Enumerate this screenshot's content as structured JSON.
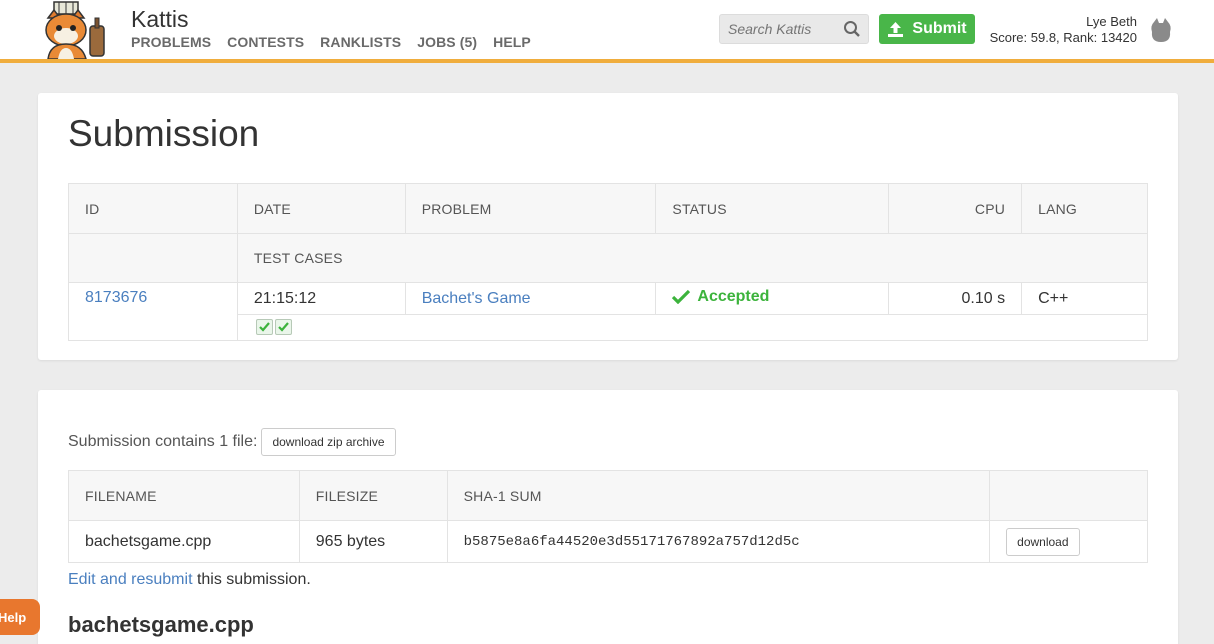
{
  "header": {
    "brand": "Kattis",
    "nav": [
      "PROBLEMS",
      "CONTESTS",
      "RANKLISTS",
      "JOBS (5)",
      "HELP"
    ],
    "search_placeholder": "Search Kattis",
    "submit_label": "Submit",
    "user_name": "Lye Beth",
    "user_score": "Score: 59.8, Rank: 13420",
    "accent_color": "#f0ad3d"
  },
  "submission": {
    "title": "Submission",
    "columns": [
      "ID",
      "DATE",
      "PROBLEM",
      "STATUS",
      "CPU",
      "LANG"
    ],
    "test_cases_label": "TEST CASES",
    "row": {
      "id": "8173676",
      "date": "21:15:12",
      "problem": "Bachet's Game",
      "status": "Accepted",
      "cpu": "0.10 s",
      "lang": "C++"
    },
    "test_case_results": [
      "passed",
      "passed"
    ],
    "status_color": "#3cb33c"
  },
  "files": {
    "contains_text": "Submission contains 1 file:",
    "download_zip_label": "download zip archive",
    "columns": [
      "FILENAME",
      "FILESIZE",
      "SHA-1 SUM",
      ""
    ],
    "row": {
      "filename": "bachetsgame.cpp",
      "filesize": "965 bytes",
      "sha1": "b5875e8a6fa44520e3d55171767892a757d12d5c",
      "download_label": "download"
    },
    "edit_link": "Edit and resubmit",
    "edit_suffix": " this submission.",
    "file_title": "bachetsgame.cpp"
  },
  "help_tab": "Help"
}
